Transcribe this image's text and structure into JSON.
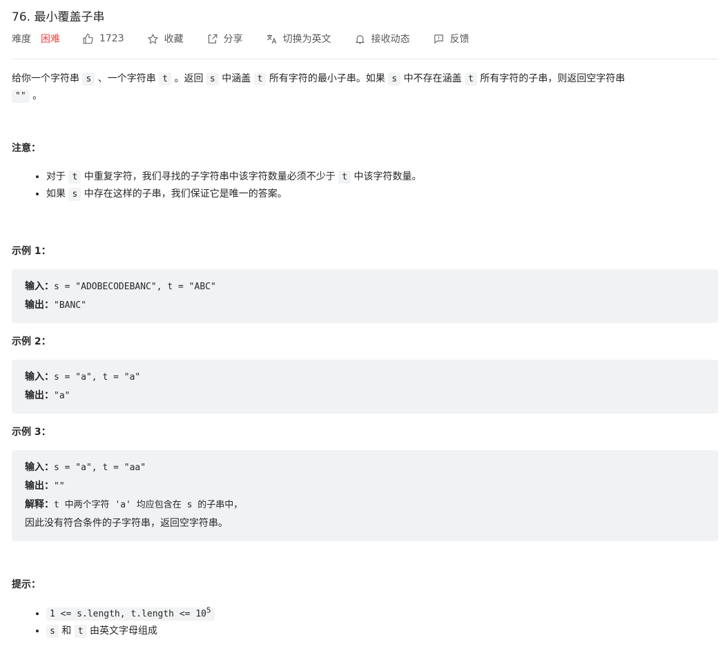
{
  "problem": {
    "title": "76. 最小覆盖子串",
    "difficulty_label": "难度",
    "difficulty": "困难",
    "likes": "1723",
    "actions": {
      "favorite": "收藏",
      "share": "分享",
      "switch_lang": "切换为英文",
      "subscribe": "接收动态",
      "feedback": "反馈"
    }
  },
  "description": {
    "p1_a": "给你一个字符串 ",
    "s": "s",
    "p1_b": " 、一个字符串 ",
    "t": "t",
    "p1_c": " 。返回 ",
    "p1_d": " 中涵盖 ",
    "p1_e": " 所有字符的最小子串。如果 ",
    "p1_f": " 中不存在涵盖 ",
    "p1_g": " 所有字符的子串，则返回空字符串",
    "empty": "\"\"",
    "p1_end": " 。"
  },
  "note": {
    "heading": "注意：",
    "items": [
      {
        "a": "对于 ",
        "code": "t",
        "b": " 中重复字符，我们寻找的子字符串中该字符数量必须不少于 ",
        "code2": "t",
        "c": " 中该字符数量。"
      },
      {
        "a": "如果 ",
        "code": "s",
        "b": " 中存在这样的子串，我们保证它是唯一的答案。"
      }
    ]
  },
  "examples": [
    {
      "heading": "示例 1：",
      "input_label": "输入：",
      "input": "s = \"ADOBECODEBANC\", t = \"ABC\"",
      "output_label": "输出：",
      "output": "\"BANC\""
    },
    {
      "heading": "示例 2：",
      "input_label": "输入：",
      "input": "s = \"a\", t = \"a\"",
      "output_label": "输出：",
      "output": "\"a\""
    },
    {
      "heading": "示例 3：",
      "input_label": "输入：",
      "input": "s = \"a\", t = \"aa\"",
      "output_label": "输出：",
      "output": "\"\"",
      "explain_label": "解释：",
      "explain_a": "t 中两个字符 'a' 均应包含在 s 的子串中，",
      "explain_b": "因此没有符合条件的子字符串，返回空字符串。"
    }
  ],
  "hints": {
    "heading": "提示：",
    "c1": "1 <= s.length, t.length <= 10",
    "c1_sup": "5",
    "c2_s": "s",
    "c2_and": " 和 ",
    "c2_t": "t",
    "c2_rest": " 由英文字母组成"
  }
}
